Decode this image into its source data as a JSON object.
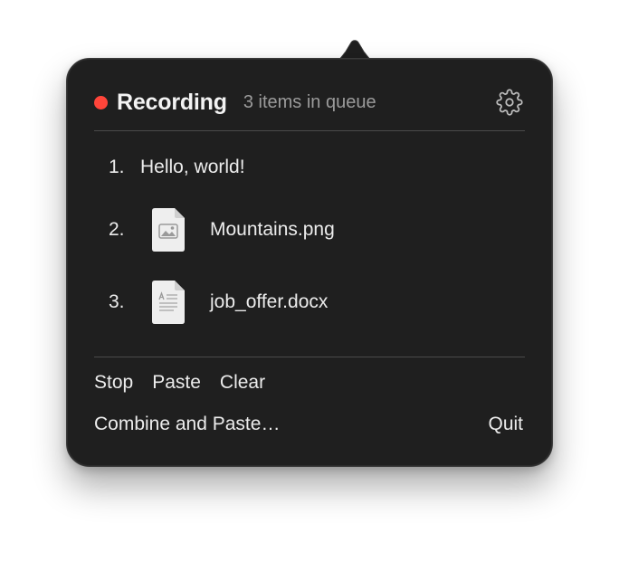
{
  "header": {
    "status_label": "Recording",
    "queue_text": "3 items in queue",
    "settings_icon": "gear-icon"
  },
  "colors": {
    "recording_dot": "#ff453a",
    "panel_bg": "#1f1f1f",
    "text_primary": "#ececec",
    "text_secondary": "#9b9b9b"
  },
  "queue": [
    {
      "number": "1.",
      "label": "Hello, world!",
      "type": "text"
    },
    {
      "number": "2.",
      "label": "Mountains.png",
      "type": "image",
      "icon": "image-file-icon"
    },
    {
      "number": "3.",
      "label": "job_offer.docx",
      "type": "document",
      "icon": "document-file-icon"
    }
  ],
  "actions": {
    "stop": "Stop",
    "paste": "Paste",
    "clear": "Clear",
    "combine_paste": "Combine and Paste…",
    "quit": "Quit"
  }
}
